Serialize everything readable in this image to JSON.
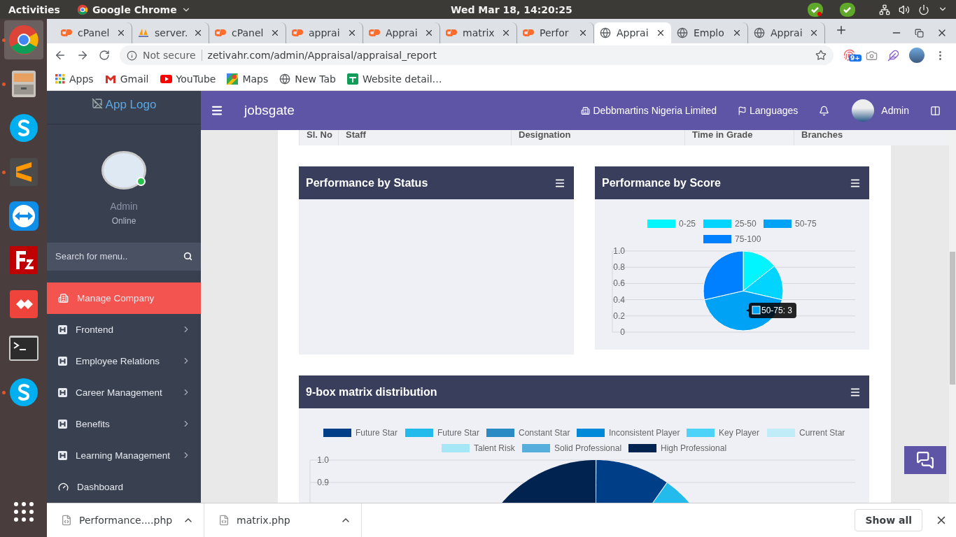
{
  "system_bar": {
    "activities": "Activities",
    "app_name": "Google Chrome",
    "clock": "Wed Mar 18, 14:20:25"
  },
  "dock": [
    {
      "kind": "chrome",
      "running": true,
      "selected": true
    },
    {
      "kind": "files",
      "running": true,
      "selected": false
    },
    {
      "kind": "skype",
      "running": false,
      "selected": false
    },
    {
      "kind": "sublime",
      "running": true,
      "selected": false
    },
    {
      "kind": "teamviewer",
      "running": false,
      "selected": false
    },
    {
      "kind": "filezilla",
      "running": false,
      "selected": false
    },
    {
      "kind": "anydesk",
      "running": false,
      "selected": false
    },
    {
      "kind": "terminal",
      "running": false,
      "selected": false
    },
    {
      "kind": "skype",
      "running": true,
      "selected": false
    }
  ],
  "tabs": [
    {
      "kind": "cpanel",
      "title": "cPanel",
      "selected": false
    },
    {
      "kind": "pma",
      "title": "server.",
      "selected": false
    },
    {
      "kind": "cpanel",
      "title": "cPanel",
      "selected": false
    },
    {
      "kind": "cpanel",
      "title": "apprai",
      "selected": false
    },
    {
      "kind": "cpanel",
      "title": "Apprai",
      "selected": false
    },
    {
      "kind": "cpanel",
      "title": "matrix",
      "selected": false
    },
    {
      "kind": "cpanel",
      "title": "Perfor",
      "selected": false
    },
    {
      "kind": "globe",
      "title": "Apprai",
      "selected": true
    },
    {
      "kind": "globe",
      "title": "Emplo",
      "selected": false
    },
    {
      "kind": "globe",
      "title": "Apprai",
      "selected": false
    }
  ],
  "address_bar": {
    "security": "Not secure",
    "url": "zetivahr.com/admin/Appraisal/appraisal_report",
    "extension_badge": "9+"
  },
  "bookmarks": [
    {
      "kind": "apps",
      "label": "Apps"
    },
    {
      "kind": "gmail",
      "label": "Gmail"
    },
    {
      "kind": "youtube",
      "label": "YouTube"
    },
    {
      "kind": "maps",
      "label": "Maps"
    },
    {
      "kind": "globe",
      "label": "New Tab"
    },
    {
      "kind": "sheet",
      "label": "Website detail…"
    }
  ],
  "sidebar": {
    "logo": "App Logo",
    "user": "Admin",
    "status": "Online",
    "search": {
      "placeholder": "Search for menu.."
    },
    "items": [
      {
        "kind": "building",
        "label": "Manage Company",
        "selected": true,
        "submenu": false
      },
      {
        "kind": "h",
        "label": "Frontend",
        "selected": false,
        "submenu": true
      },
      {
        "kind": "h",
        "label": "Employee Relations",
        "selected": false,
        "submenu": true
      },
      {
        "kind": "h",
        "label": "Career Management",
        "selected": false,
        "submenu": true
      },
      {
        "kind": "h",
        "label": "Benefits",
        "selected": false,
        "submenu": true
      },
      {
        "kind": "h",
        "label": "Learning Management",
        "selected": false,
        "submenu": true
      },
      {
        "kind": "gauge",
        "label": "Dashboard",
        "selected": false,
        "submenu": false
      }
    ]
  },
  "header": {
    "brand": "jobsgate",
    "company": "Debbmartins Nigeria Limited",
    "languages": "Languages",
    "user": "Admin"
  },
  "table": {
    "columns": [
      "Sl. No",
      "Staff",
      "Designation",
      "Time in Grade",
      "Branches"
    ]
  },
  "panels": [
    {
      "title": "Performance by Status"
    },
    {
      "title": "Performance by Score",
      "axis_labels": [
        "1.0",
        "0.8",
        "0.6",
        "0.4",
        "0.2",
        "0"
      ],
      "tooltip": "50-75: 3",
      "chart_data": {
        "type": "pie",
        "categories": [
          "0-25",
          "25-50",
          "50-75",
          "75-100"
        ],
        "values": [
          14.3,
          14.3,
          42.8,
          28.6
        ],
        "colors": [
          "#00f5ff",
          "#00d4ff",
          "#00a2f5",
          "#0080ff"
        ],
        "legend": "top"
      }
    }
  ],
  "matrix_panel": {
    "title": "9-box matrix distribution",
    "legend": [
      {
        "label": "Future Star",
        "color": "#003f88"
      },
      {
        "label": "Future Star",
        "color": "#22bbeb"
      },
      {
        "label": "Constant Star",
        "color": "#2a8bc4"
      },
      {
        "label": "Inconsistent Player",
        "color": "#0088d9"
      },
      {
        "label": "Key Player",
        "color": "#4dd3f7"
      },
      {
        "label": "Current Star",
        "color": "#c0ecf7"
      },
      {
        "label": "Talent Risk",
        "color": "#a5e6f7"
      },
      {
        "label": "Solid Professional",
        "color": "#55aedb"
      },
      {
        "label": "High Professional",
        "color": "#00234f"
      }
    ],
    "axis_labels": [
      "1.0",
      "0.9"
    ]
  },
  "downloads": {
    "items": [
      "Performance....php",
      "matrix.php"
    ],
    "show_all": "Show all"
  }
}
